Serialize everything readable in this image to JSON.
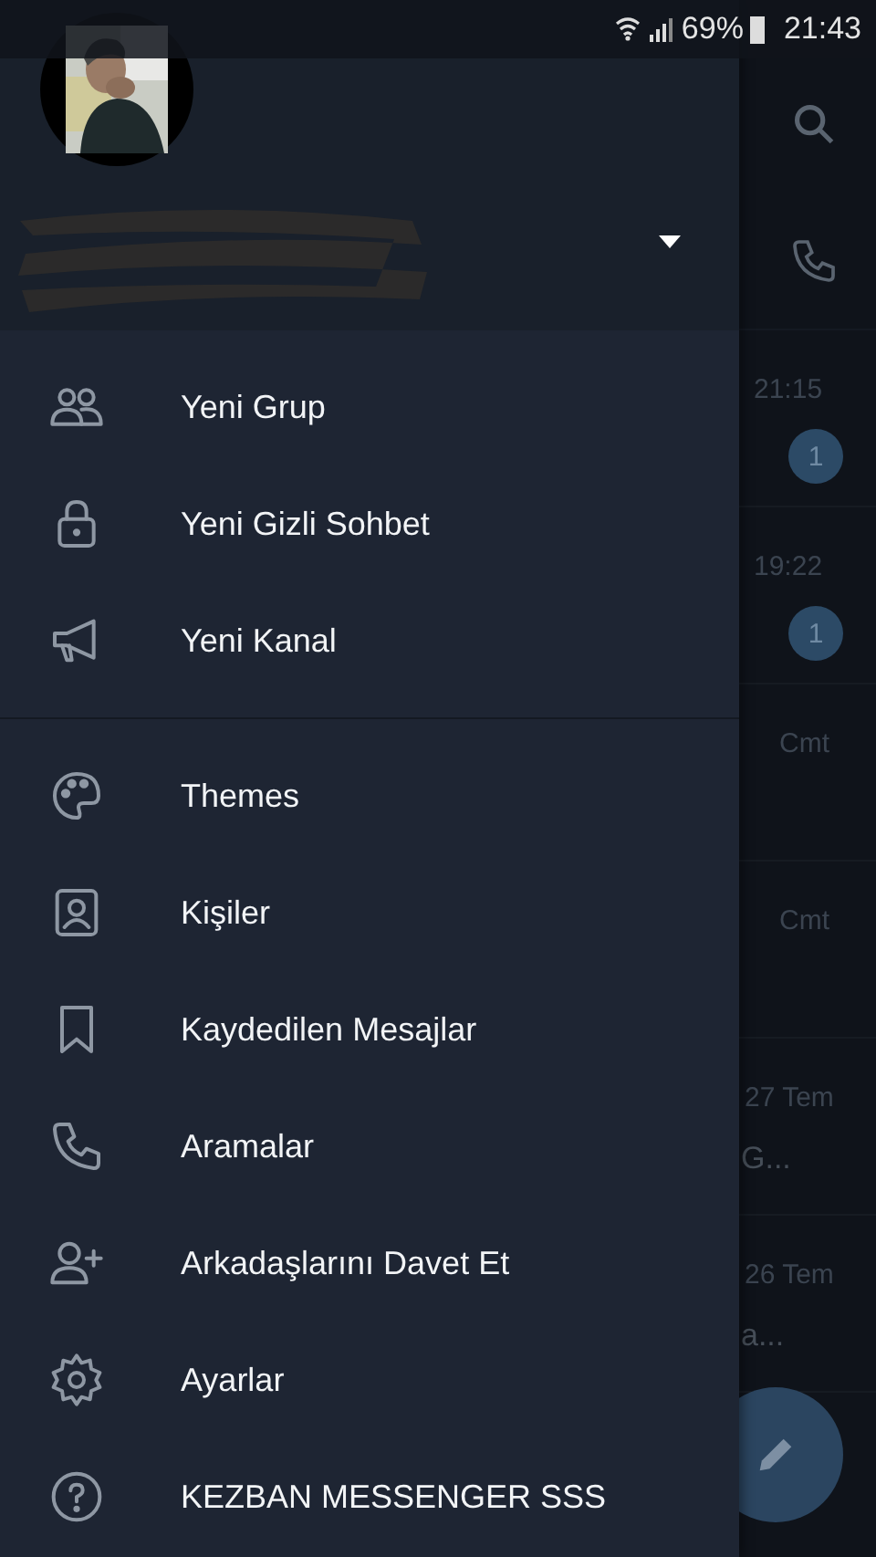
{
  "status_bar": {
    "battery": "69%",
    "time": "21:43"
  },
  "drawer": {
    "menu_sections": [
      [
        {
          "label": "Yeni Grup"
        },
        {
          "label": "Yeni Gizli Sohbet"
        },
        {
          "label": "Yeni Kanal"
        }
      ],
      [
        {
          "label": "Themes"
        },
        {
          "label": "Kişiler"
        },
        {
          "label": "Kaydedilen Mesajlar"
        },
        {
          "label": "Aramalar"
        },
        {
          "label": "Arkadaşlarını Davet Et"
        },
        {
          "label": "Ayarlar"
        },
        {
          "label": "KEZBAN MESSENGER SSS"
        }
      ]
    ]
  },
  "background_chats": [
    {
      "time": "21:15",
      "badge": "1"
    },
    {
      "time": "19:22",
      "badge": "1"
    },
    {
      "time": "Cmt"
    },
    {
      "time": "Cmt"
    },
    {
      "time": "27 Tem",
      "preview": "G..."
    },
    {
      "time": "26 Tem",
      "preview": "a..."
    }
  ]
}
